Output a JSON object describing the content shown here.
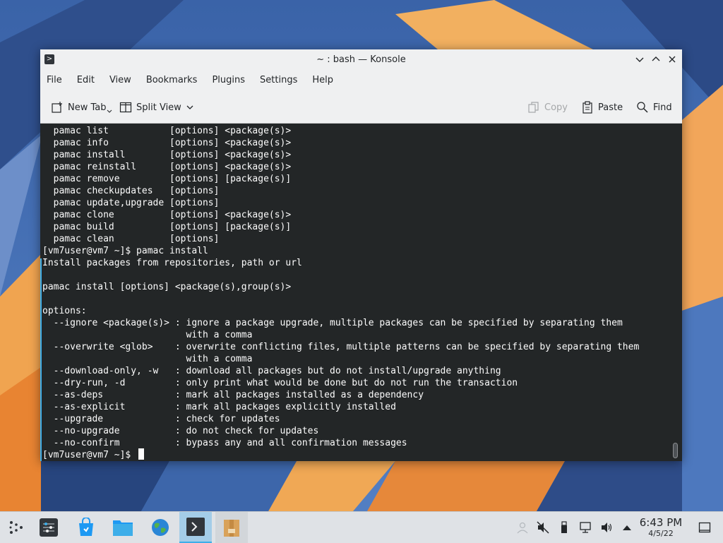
{
  "window": {
    "title": "~ : bash — Konsole",
    "app_icon": "terminal-icon"
  },
  "menu": [
    "File",
    "Edit",
    "View",
    "Bookmarks",
    "Plugins",
    "Settings",
    "Help"
  ],
  "toolbar": {
    "new_tab": "New Tab",
    "split_view": "Split View",
    "copy": "Copy",
    "paste": "Paste",
    "find": "Find"
  },
  "terminal": {
    "lines": [
      "  pamac list           [options] <package(s)>",
      "  pamac info           [options] <package(s)>",
      "  pamac install        [options] <package(s)>",
      "  pamac reinstall      [options] <package(s)>",
      "  pamac remove         [options] [package(s)]",
      "  pamac checkupdates   [options]",
      "  pamac update,upgrade [options]",
      "  pamac clone          [options] <package(s)>",
      "  pamac build          [options] [package(s)]",
      "  pamac clean          [options]",
      "[vm7user@vm7 ~]$ pamac install",
      "Install packages from repositories, path or url",
      "",
      "pamac install [options] <package(s),group(s)>",
      "",
      "options:",
      "  --ignore <package(s)> : ignore a package upgrade, multiple packages can be specified by separating them",
      "                          with a comma",
      "  --overwrite <glob>    : overwrite conflicting files, multiple patterns can be specified by separating them",
      "                          with a comma",
      "  --download-only, -w   : download all packages but do not install/upgrade anything",
      "  --dry-run, -d         : only print what would be done but do not run the transaction",
      "  --as-deps             : mark all packages installed as a dependency",
      "  --as-explicit         : mark all packages explicitly installed",
      "  --upgrade             : check for updates",
      "  --no-upgrade          : do not check for updates",
      "  --no-confirm          : bypass any and all confirmation messages",
      "[vm7user@vm7 ~]$ "
    ]
  },
  "taskbar": {
    "apps": [
      "application-launcher-icon",
      "system-settings-icon",
      "discover-store-icon",
      "dolphin-folder-icon",
      "web-browser-globe-icon",
      "konsole-terminal-icon",
      "archive-package-icon"
    ],
    "tray": [
      "user-icon",
      "audio-muted-icon",
      "removable-device-icon",
      "network-wired-icon",
      "volume-icon",
      "expand-tray-arrow-icon",
      "show-desktop-icon"
    ],
    "time": "6:43 PM",
    "date": "4/5/22"
  },
  "colors": {
    "terminal_bg": "#232627",
    "terminal_fg": "#fcfcfc",
    "accent": "#3daee9",
    "window_bg": "#eff0f1",
    "taskbar_bg": "#dfe2e6"
  }
}
